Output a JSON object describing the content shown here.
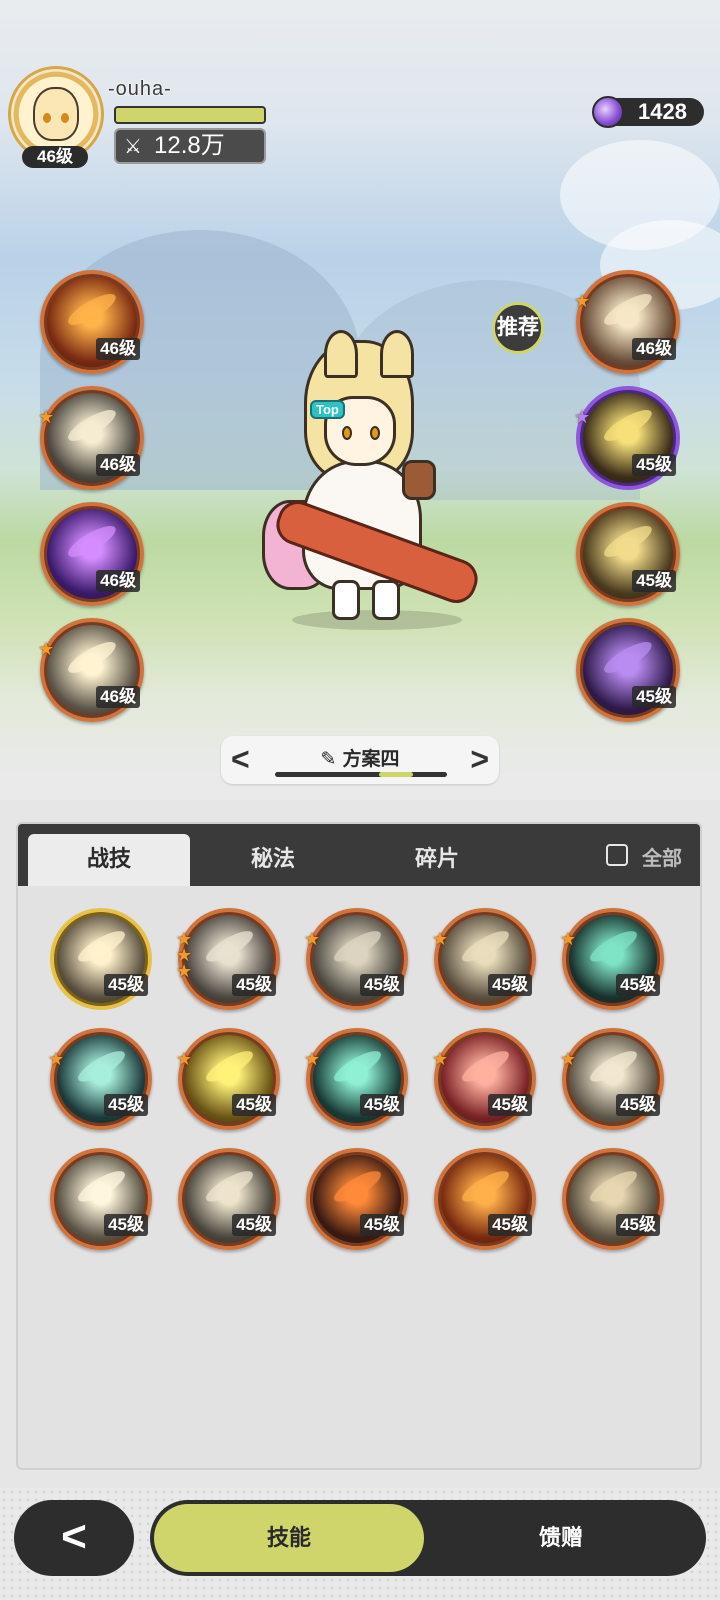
{
  "player": {
    "name": "-ouha-",
    "level_badge": "46级",
    "xp_fraction": 1.0,
    "power": "12.8万"
  },
  "currency": {
    "amount": "1428",
    "icon": "purple-gem-icon"
  },
  "recommend_label": "推荐",
  "equipped_left": [
    {
      "name": "flame-vortex",
      "level": "46级",
      "stars": 0,
      "bg": "#7a2a12",
      "fx": "#ffb34a"
    },
    {
      "name": "impact-strike",
      "level": "46级",
      "stars": 1,
      "bg": "#4c4840",
      "fx": "#f5ecd2"
    },
    {
      "name": "violet-orb",
      "level": "46级",
      "stars": 0,
      "bg": "#3a1a6b",
      "fx": "#d48cff"
    },
    {
      "name": "light-slash",
      "level": "46级",
      "stars": 1,
      "bg": "#5a5448",
      "fx": "#fff3d2"
    }
  ],
  "equipped_right": [
    {
      "name": "sword-buff",
      "level": "46级",
      "stars": 1,
      "bg": "#6a4e3a",
      "fx": "#f6e7c6",
      "rim": "orange"
    },
    {
      "name": "golden-spirit",
      "level": "45级",
      "stars": 1,
      "bg": "#3a2c18",
      "fx": "#f7e07a",
      "rim": "purple"
    },
    {
      "name": "heal-aura",
      "level": "45级",
      "stars": 0,
      "bg": "#4a3a1e",
      "fx": "#f2dc8c",
      "rim": "orange"
    },
    {
      "name": "shadow-summon",
      "level": "45级",
      "stars": 0,
      "bg": "#2e1a4a",
      "fx": "#b98cf2",
      "rim": "orange"
    }
  ],
  "character_tag": "Top",
  "preset": {
    "name": "方案四",
    "prev": "<",
    "next": ">"
  },
  "tabs": [
    {
      "label": "战技",
      "active": true
    },
    {
      "label": "秘法",
      "active": false
    },
    {
      "label": "碎片",
      "active": false
    }
  ],
  "filter_all_label": "全部",
  "skill_grid": [
    {
      "level": "45级",
      "stars": 0,
      "bg": "#5a4f3e",
      "fx": "#fff1cc",
      "rim": "gold"
    },
    {
      "level": "45级",
      "stars": 3,
      "bg": "#4c4640",
      "fx": "#e9e1d0",
      "rim": "orange"
    },
    {
      "level": "45级",
      "stars": 1,
      "bg": "#4e4a42",
      "fx": "#dcd4c0",
      "rim": "orange"
    },
    {
      "level": "45级",
      "stars": 1,
      "bg": "#5a5040",
      "fx": "#e9dcbc",
      "rim": "orange"
    },
    {
      "level": "45级",
      "stars": 1,
      "bg": "#18322e",
      "fx": "#7fe3c6",
      "rim": "orange"
    },
    {
      "level": "45级",
      "stars": 1,
      "bg": "#1c3a3a",
      "fx": "#a8eedc",
      "rim": "orange"
    },
    {
      "level": "45级",
      "stars": 1,
      "bg": "#6a5416",
      "fx": "#fff27a",
      "rim": "orange"
    },
    {
      "level": "45级",
      "stars": 1,
      "bg": "#183a36",
      "fx": "#8ff0d4",
      "rim": "orange"
    },
    {
      "level": "45级",
      "stars": 1,
      "bg": "#7a2226",
      "fx": "#ffb1a0",
      "rim": "orange"
    },
    {
      "level": "45级",
      "stars": 1,
      "bg": "#5e5648",
      "fx": "#f1e7d0",
      "rim": "orange"
    },
    {
      "level": "45级",
      "stars": 0,
      "bg": "#5a5446",
      "fx": "#fff6de",
      "rim": "orange"
    },
    {
      "level": "45级",
      "stars": 0,
      "bg": "#4a463e",
      "fx": "#eee4cc",
      "rim": "orange"
    },
    {
      "level": "45级",
      "stars": 0,
      "bg": "#3a1a12",
      "fx": "#ff8a3a",
      "rim": "orange"
    },
    {
      "level": "45级",
      "stars": 0,
      "bg": "#7a2a10",
      "fx": "#ffb04a",
      "rim": "orange"
    },
    {
      "level": "45级",
      "stars": 0,
      "bg": "#5a5040",
      "fx": "#e7d6b0",
      "rim": "orange"
    }
  ],
  "bottom_nav": {
    "back_label": "<",
    "skills_label": "技能",
    "gift_label": "馈赠"
  }
}
